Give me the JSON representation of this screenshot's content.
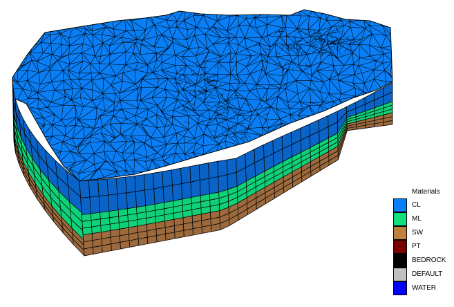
{
  "legend": {
    "title": "Materials",
    "entries": [
      {
        "label": "CL",
        "color": "#0a7ff5"
      },
      {
        "label": "ML",
        "color": "#0fe07d"
      },
      {
        "label": "SW",
        "color": "#c08040"
      },
      {
        "label": "PT",
        "color": "#7a0000"
      },
      {
        "label": "BEDROCK",
        "color": "#000000"
      },
      {
        "label": "DEFAULT",
        "color": "#c0c0c0"
      },
      {
        "label": "WATER",
        "color": "#0000ff"
      }
    ]
  },
  "colors": {
    "cl_top": "#0a7ff5",
    "cl_side": "#0a64c8",
    "ml_side": "#0fd278",
    "sw_side": "#9c6a3c",
    "mesh_line": "#000000"
  }
}
